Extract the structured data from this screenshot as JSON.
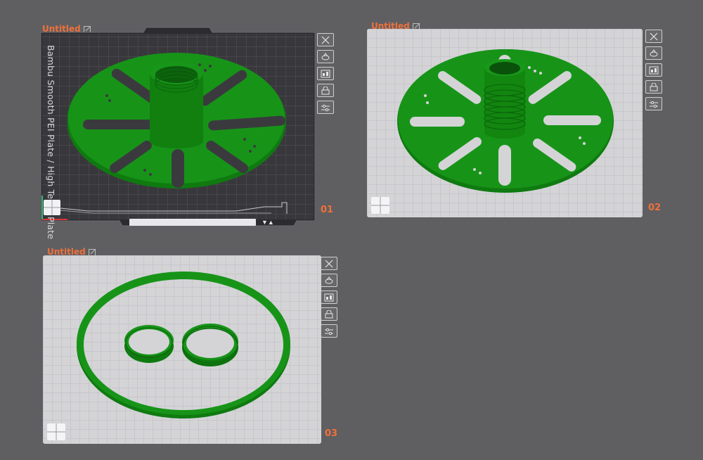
{
  "plates": [
    {
      "title": "Untitled",
      "number": "01",
      "plate_label": "Bambu Smooth PEI Plate / High Temp Plate",
      "style": "dark-textured",
      "contents": "spool flange with threaded hub"
    },
    {
      "title": "Untitled",
      "number": "02",
      "style": "light-grid",
      "contents": "spool flange with threaded hub"
    },
    {
      "title": "Untitled",
      "number": "03",
      "style": "light-grid",
      "contents": "outer ring and two threaded collars"
    }
  ],
  "plate_tools": [
    {
      "icon": "close-icon",
      "label": "Remove plate"
    },
    {
      "icon": "orient-icon",
      "label": "Auto orient"
    },
    {
      "icon": "arrange-icon",
      "label": "Arrange"
    },
    {
      "icon": "lock-icon",
      "label": "Lock plate"
    },
    {
      "icon": "settings-icon",
      "label": "Plate settings"
    }
  ],
  "colors": {
    "background": "#5f5f62",
    "accent": "#f0703a",
    "part_green": "#169117",
    "dark_plate": "#3a3a3e",
    "light_plate": "#cdcdd0"
  }
}
